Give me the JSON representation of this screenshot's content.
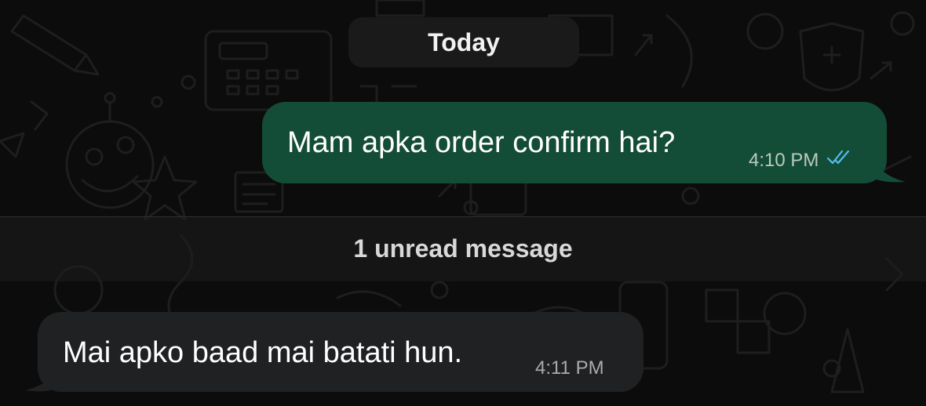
{
  "date_separator": "Today",
  "messages": [
    {
      "direction": "outgoing",
      "text": "Mam apka order confirm hai?",
      "time": "4:10 PM",
      "status": "read",
      "status_icon": "double-check-icon",
      "status_color": "#53bdeb"
    },
    {
      "direction": "incoming",
      "text": "Mai apko baad mai batati hun.",
      "time": "4:11 PM"
    }
  ],
  "unread_banner": "1 unread message",
  "colors": {
    "background": "#0c0c0c",
    "outgoing_bubble": "#144d37",
    "incoming_bubble": "#1f2123",
    "read_ticks": "#53bdeb"
  }
}
